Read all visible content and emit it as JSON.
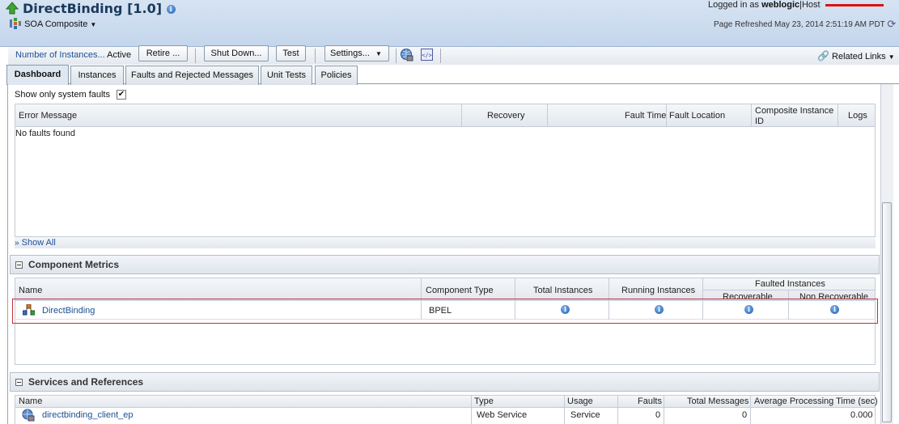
{
  "header": {
    "title": "DirectBinding [1.0]",
    "soa_menu": "SOA Composite",
    "logged_in_label": "Logged in as",
    "user": "weblogic",
    "host_label": "|Host",
    "page_refreshed": "Page Refreshed May 23, 2014 2:51:19 AM PDT"
  },
  "toolbar": {
    "instances_label": "Number of Instances...",
    "status": "Active",
    "retire": "Retire ...",
    "shutdown": "Shut Down...",
    "test": "Test",
    "settings": "Settings...",
    "related_links": "Related Links"
  },
  "tabs": [
    {
      "label": "Dashboard",
      "active": true
    },
    {
      "label": "Instances",
      "active": false
    },
    {
      "label": "Faults and Rejected Messages",
      "active": false
    },
    {
      "label": "Unit Tests",
      "active": false
    },
    {
      "label": "Policies",
      "active": false
    }
  ],
  "faults": {
    "show_only_system_faults": "Show only system faults",
    "checked": true,
    "columns": [
      "Error Message",
      "Recovery",
      "Fault Time",
      "Fault Location",
      "Composite Instance ID",
      "Logs"
    ],
    "empty_text": "No faults found",
    "show_all": "Show All"
  },
  "component_metrics": {
    "title": "Component Metrics",
    "columns": {
      "name": "Name",
      "type": "Component Type",
      "total": "Total Instances",
      "running": "Running Instances",
      "faulted": "Faulted Instances",
      "recoverable": "Recoverable",
      "non_recoverable": "Non Recoverable"
    },
    "rows": [
      {
        "name": "DirectBinding",
        "type": "BPEL"
      }
    ]
  },
  "services": {
    "title": "Services and References",
    "columns": {
      "name": "Name",
      "type": "Type",
      "usage": "Usage",
      "faults": "Faults",
      "total": "Total Messages",
      "avg": "Average Processing Time (sec)"
    },
    "rows": [
      {
        "name": "directbinding_client_ep",
        "type": "Web Service",
        "usage": "Service",
        "faults": "0",
        "total": "0",
        "avg": "0.000"
      }
    ]
  },
  "colors": {
    "header_bg": "#c8d9ee",
    "link": "#1d4f91",
    "highlight_border": "#c0303a"
  }
}
